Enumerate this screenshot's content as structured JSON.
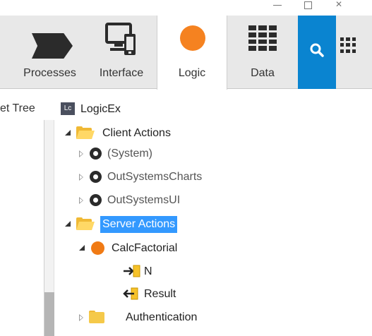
{
  "toolbar": {
    "tabs": [
      {
        "label": "Processes",
        "icon": "process-icon"
      },
      {
        "label": "Interface",
        "icon": "interface-icon"
      },
      {
        "label": "Logic",
        "icon": "logic-icon",
        "active": true
      },
      {
        "label": "Data",
        "icon": "data-icon"
      }
    ],
    "search_icon": "search-icon",
    "more_icon": "grid-icon",
    "colors": {
      "bar": "#e8e8e8",
      "active_tab": "#ffffff",
      "search": "#0a84d0",
      "logic": "#f58220"
    }
  },
  "tree": {
    "left_tab_label": "et Tree",
    "root": {
      "badge": "Lc",
      "label": "LogicEx"
    },
    "rows": [
      {
        "label": "Client Actions",
        "icon": "folder-open-icon",
        "state": "expanded"
      },
      {
        "label": "(System)",
        "icon": "module-icon",
        "state": "collapsed"
      },
      {
        "label": "OutSystemsCharts",
        "icon": "module-icon",
        "state": "collapsed"
      },
      {
        "label": "OutSystemsUI",
        "icon": "module-icon",
        "state": "collapsed"
      },
      {
        "label": "Server Actions",
        "icon": "folder-open-icon",
        "state": "expanded",
        "selected": true
      },
      {
        "label": "CalcFactorial",
        "icon": "action-icon",
        "state": "expanded"
      },
      {
        "label": "N",
        "icon": "input-parameter-icon"
      },
      {
        "label": "Result",
        "icon": "output-parameter-icon"
      },
      {
        "label": "Authentication",
        "icon": "folder-icon",
        "state": "collapsed"
      }
    ],
    "colors": {
      "selection": "#3399ff",
      "folder": "#f0b935",
      "action": "#f07a14"
    }
  }
}
